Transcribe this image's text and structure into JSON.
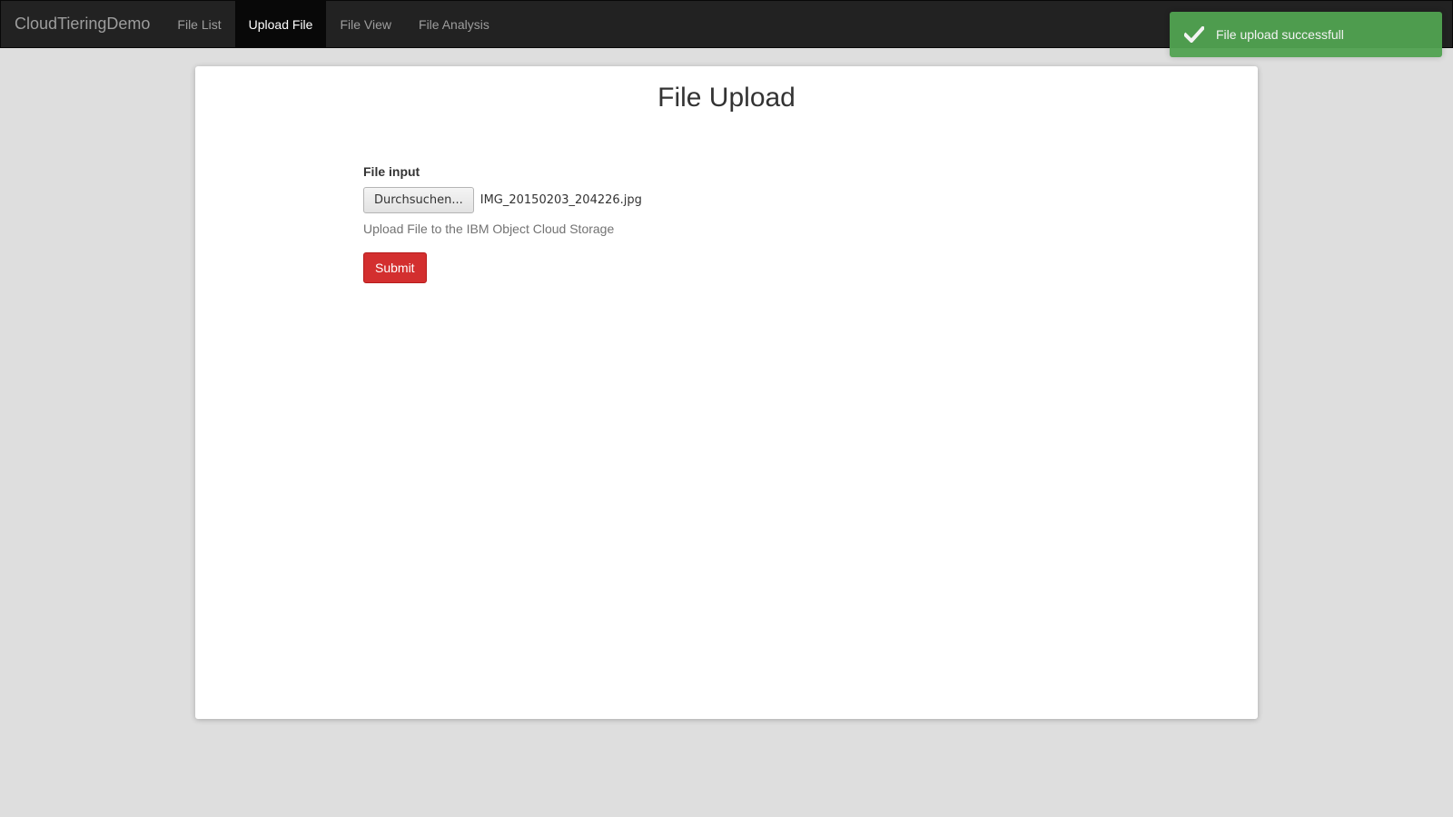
{
  "navbar": {
    "brand": "CloudTieringDemo",
    "items": [
      {
        "label": "File List",
        "active": false
      },
      {
        "label": "Upload File",
        "active": true
      },
      {
        "label": "File View",
        "active": false
      },
      {
        "label": "File Analysis",
        "active": false
      }
    ],
    "background_color": "#222222"
  },
  "main": {
    "title": "File Upload",
    "form": {
      "label": "File input",
      "browse_button_label": "Durchsuchen...",
      "selected_file": "IMG_20150203_204226.jpg",
      "help_text": "Upload File to the IBM Object Cloud Storage",
      "submit_label": "Submit",
      "submit_color": "#d32f2f"
    }
  },
  "toast": {
    "message": "File upload successfull",
    "icon": "checkmark-icon",
    "color": "#51a351"
  }
}
